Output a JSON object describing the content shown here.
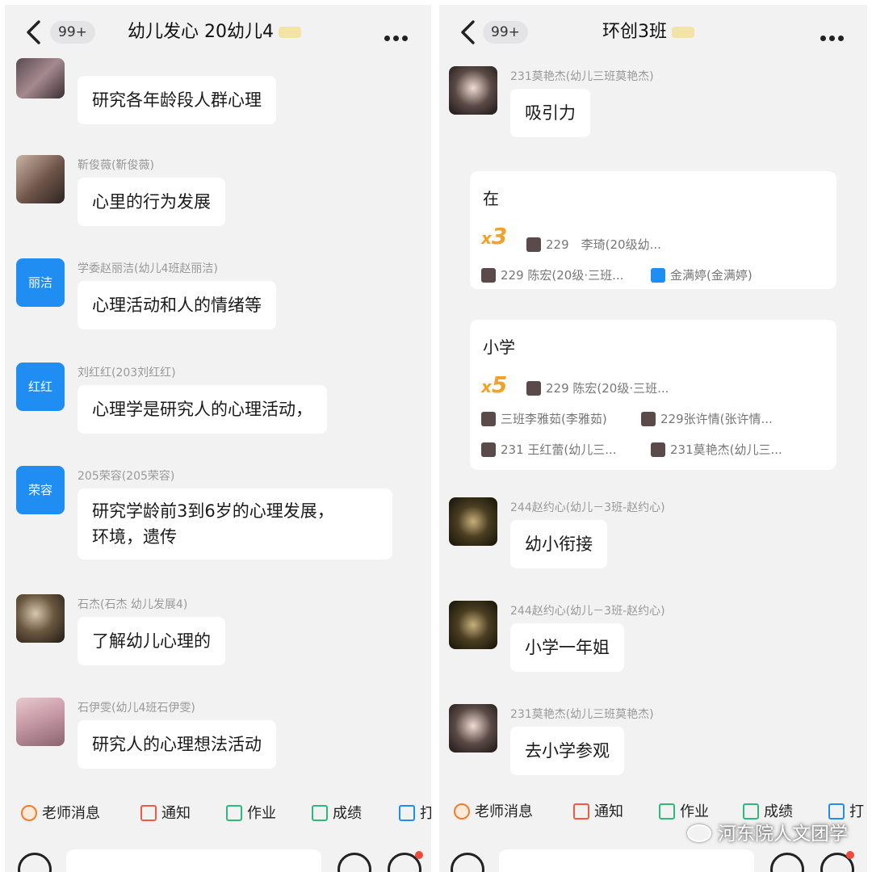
{
  "left": {
    "header": {
      "unread": "99+",
      "title": "幼儿发心 20幼儿4"
    },
    "messages": [
      {
        "sender": "",
        "text": "研究各年龄段人群心理"
      },
      {
        "sender": "靳俊薇(靳俊薇)",
        "text": "心里的行为发展"
      },
      {
        "sender": "学委赵丽洁(幼儿4班赵丽洁)",
        "avatar": "丽洁",
        "text": "心理活动和人的情绪等"
      },
      {
        "sender": "刘红红(203刘红红)",
        "avatar": "红红",
        "text": "心理学是研究人的心理活动，"
      },
      {
        "sender": "205荣容(205荣容)",
        "avatar": "荣容",
        "text": "研究学龄前3到6岁的心理发展，",
        "text2": "环境，遗传"
      },
      {
        "sender": "石杰(石杰 幼儿发展4)",
        "text": "了解幼儿心理的"
      },
      {
        "sender": "石伊雯(幼儿4班石伊雯)",
        "text": "研究人的心理想法活动"
      }
    ],
    "tools": [
      "老师消息",
      "通知",
      "作业",
      "成绩",
      "打"
    ]
  },
  "right": {
    "header": {
      "unread": "99+",
      "title": "环创3班"
    },
    "msg1": {
      "sender": "231莫艳杰(幼儿三班莫艳杰)",
      "text": "吸引力"
    },
    "card1": {
      "word": "在",
      "x": "x",
      "count": "3",
      "names": [
        "229　李琦(20级幼...",
        "229 陈宏(20级·三班...",
        "金满婷(金满婷)"
      ]
    },
    "card2": {
      "word": "小学",
      "x": "x",
      "count": "5",
      "names": [
        "229 陈宏(20级·三班...",
        "三班李雅茹(李雅茹)",
        "229张许情(张许情...",
        "231 王红蕾(幼儿三...",
        "231莫艳杰(幼儿三..."
      ]
    },
    "msg2": {
      "sender": "244赵约心(幼儿－3班-赵约心)",
      "text": "幼小衔接"
    },
    "msg3": {
      "sender": "244赵约心(幼儿－3班-赵约心)",
      "text": "小学一年姐"
    },
    "msg4": {
      "sender": "231莫艳杰(幼儿三班莫艳杰)",
      "text": "去小学参观"
    },
    "tools": [
      "老师消息",
      "通知",
      "作业",
      "成绩",
      "打"
    ]
  },
  "watermark": "河东院人文团学"
}
